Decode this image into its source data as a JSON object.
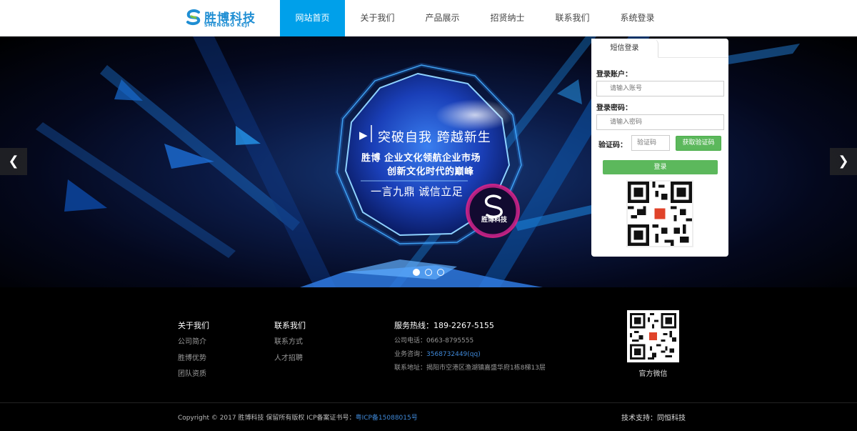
{
  "header": {
    "logo": {
      "cn": "胜博科技",
      "en": "SHENGBO KEJI"
    },
    "nav": [
      {
        "label": "网站首页",
        "active": true
      },
      {
        "label": "关于我们"
      },
      {
        "label": "产品展示"
      },
      {
        "label": "招贤纳士"
      },
      {
        "label": "联系我们"
      },
      {
        "label": "系统登录"
      }
    ]
  },
  "banner": {
    "slogan_main": "突破自我  跨越新生",
    "slogan_line2": "胜博  企业文化领航企业市场",
    "slogan_line3": "创新文化时代的巅峰",
    "slogan_line4": "一言九鼎 诚信立足",
    "badge_name": "胜博科技",
    "slides_total": 3,
    "active_slide": 1,
    "prev_icon": "chevron-left",
    "next_icon": "chevron-right"
  },
  "login": {
    "tab": "短信登录",
    "account_label": "登录账户：",
    "account_placeholder": "请输入账号",
    "password_label": "登录密码：",
    "password_placeholder": "请输入密码",
    "code_label": "验证码：",
    "code_placeholder": "验证码",
    "get_code_button": "获取验证码",
    "submit_button": "登录"
  },
  "footer": {
    "col1": {
      "title": "关于我们",
      "links": [
        "公司简介",
        "胜博优势",
        "团队资质"
      ]
    },
    "col2": {
      "title": "联系我们",
      "links": [
        "联系方式",
        "人才招聘"
      ]
    },
    "contact": {
      "hotline": "服务热线：189-2267-5155",
      "phone": "公司电话：0663-8795555",
      "qq_label": "业务咨询：",
      "qq_value": "3568732449(qq)",
      "address": "联系地址：揭阳市空港区渔湖镇嘉盛华府1栋8梯13层"
    },
    "wechat_label": "官方微信",
    "copyright_text": "Copyright © 2017 胜博科技 保留所有版权 ICP备案证书号：",
    "icp": "粤ICP备15088015号",
    "support": "技术支持：同恒科技"
  },
  "colors": {
    "nav_active": "#00a0ea",
    "button_green": "#5cb85c",
    "logo_blue": "#1f8ed3"
  }
}
